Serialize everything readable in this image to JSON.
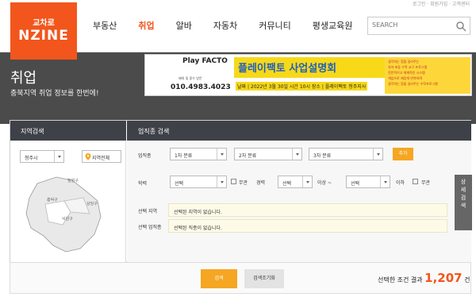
{
  "top_links": "로그인 · 회원가입 · 고객센터",
  "logo": {
    "top": "교차로",
    "main": "NZINE"
  },
  "nav": {
    "items": [
      "부동산",
      "취업",
      "알바",
      "자동차",
      "커뮤니티",
      "평생교육원"
    ],
    "active": "취업"
  },
  "search": {
    "placeholder": "SEARCH"
  },
  "banner": {
    "title": "취업",
    "subtitle": "충북지역 취업 정보를 한번에!"
  },
  "ad": {
    "play": "Play FACTO",
    "small": "배워 및 중수 방문",
    "phone": "010.4983.4023",
    "headline": "플레이팩토 사업설명회",
    "date": "날짜 | 2022년 3월 30일 시간 10시 장소 | 플레이팩토 청주지사",
    "bullets": [
      "생각하는 힘을 길러주는",
      "유아·초등 수학 교구 프로그램",
      "전문적이고 체계적인 시스템",
      "게임으로 재밌게 반복하며",
      "생각하는 힘을 길러주는 수학프로그램"
    ]
  },
  "panel": {
    "region_title": "지역검색",
    "job_title": "업직종 검색",
    "city_select": "청주시",
    "region_all": "지역전체",
    "map_labels": [
      "청원구",
      "흥덕구",
      "상당구",
      "서원구"
    ],
    "job_label": "업직종",
    "sel1": "1차 분류",
    "sel2": "2차 분류",
    "sel3": "3차 분류",
    "add_btn": "추가",
    "edu_label": "학력",
    "edu_select": "선택",
    "no_matter1": "무관",
    "career_label": "경력",
    "career_select1": "선택",
    "above": "이상 ~",
    "career_select2": "선택",
    "below": "이하",
    "no_matter2": "무관",
    "sel_region_label": "선택 지역",
    "sel_region_text": "선택된 지역이 없습니다.",
    "sel_job_label": "선택 업직종",
    "sel_job_text": "선택된 직종이 없습니다."
  },
  "side_tab": "상세검색",
  "bottom": {
    "search_btn": "검색",
    "reset_btn": "검색조기화",
    "result_prefix": "선택한 조건 결과",
    "result_count": "1,207",
    "result_suffix": "건"
  },
  "colors": {
    "brand": "#f2561d",
    "button": "#f5a623",
    "dark_header": "#3e4147"
  }
}
